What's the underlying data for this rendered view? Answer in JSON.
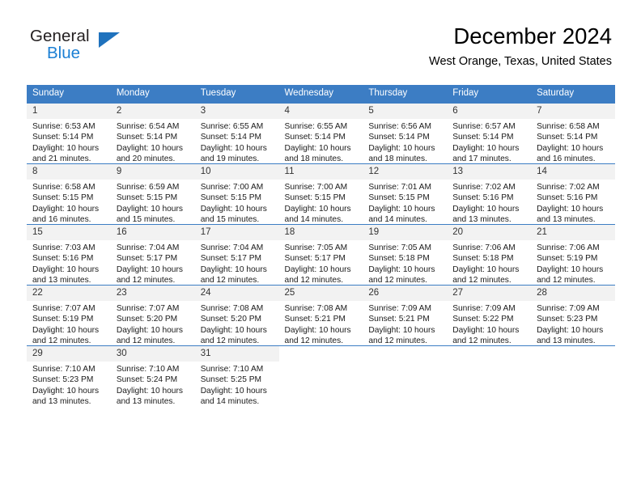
{
  "brand": {
    "name_part1": "General",
    "name_part2": "Blue",
    "logo_icon": "triangle-flag-icon",
    "accent_color": "#1f72bd"
  },
  "header": {
    "month_title": "December 2024",
    "location": "West Orange, Texas, United States"
  },
  "theme": {
    "header_row_bg": "#3c7dc4",
    "day_number_bg": "#f2f2f2",
    "text_color": "#1a1a1a"
  },
  "weekday_headers": [
    "Sunday",
    "Monday",
    "Tuesday",
    "Wednesday",
    "Thursday",
    "Friday",
    "Saturday"
  ],
  "weeks": [
    [
      {
        "day": "1",
        "detail": "Sunrise: 6:53 AM\nSunset: 5:14 PM\nDaylight: 10 hours\nand 21 minutes."
      },
      {
        "day": "2",
        "detail": "Sunrise: 6:54 AM\nSunset: 5:14 PM\nDaylight: 10 hours\nand 20 minutes."
      },
      {
        "day": "3",
        "detail": "Sunrise: 6:55 AM\nSunset: 5:14 PM\nDaylight: 10 hours\nand 19 minutes."
      },
      {
        "day": "4",
        "detail": "Sunrise: 6:55 AM\nSunset: 5:14 PM\nDaylight: 10 hours\nand 18 minutes."
      },
      {
        "day": "5",
        "detail": "Sunrise: 6:56 AM\nSunset: 5:14 PM\nDaylight: 10 hours\nand 18 minutes."
      },
      {
        "day": "6",
        "detail": "Sunrise: 6:57 AM\nSunset: 5:14 PM\nDaylight: 10 hours\nand 17 minutes."
      },
      {
        "day": "7",
        "detail": "Sunrise: 6:58 AM\nSunset: 5:14 PM\nDaylight: 10 hours\nand 16 minutes."
      }
    ],
    [
      {
        "day": "8",
        "detail": "Sunrise: 6:58 AM\nSunset: 5:15 PM\nDaylight: 10 hours\nand 16 minutes."
      },
      {
        "day": "9",
        "detail": "Sunrise: 6:59 AM\nSunset: 5:15 PM\nDaylight: 10 hours\nand 15 minutes."
      },
      {
        "day": "10",
        "detail": "Sunrise: 7:00 AM\nSunset: 5:15 PM\nDaylight: 10 hours\nand 15 minutes."
      },
      {
        "day": "11",
        "detail": "Sunrise: 7:00 AM\nSunset: 5:15 PM\nDaylight: 10 hours\nand 14 minutes."
      },
      {
        "day": "12",
        "detail": "Sunrise: 7:01 AM\nSunset: 5:15 PM\nDaylight: 10 hours\nand 14 minutes."
      },
      {
        "day": "13",
        "detail": "Sunrise: 7:02 AM\nSunset: 5:16 PM\nDaylight: 10 hours\nand 13 minutes."
      },
      {
        "day": "14",
        "detail": "Sunrise: 7:02 AM\nSunset: 5:16 PM\nDaylight: 10 hours\nand 13 minutes."
      }
    ],
    [
      {
        "day": "15",
        "detail": "Sunrise: 7:03 AM\nSunset: 5:16 PM\nDaylight: 10 hours\nand 13 minutes."
      },
      {
        "day": "16",
        "detail": "Sunrise: 7:04 AM\nSunset: 5:17 PM\nDaylight: 10 hours\nand 12 minutes."
      },
      {
        "day": "17",
        "detail": "Sunrise: 7:04 AM\nSunset: 5:17 PM\nDaylight: 10 hours\nand 12 minutes."
      },
      {
        "day": "18",
        "detail": "Sunrise: 7:05 AM\nSunset: 5:17 PM\nDaylight: 10 hours\nand 12 minutes."
      },
      {
        "day": "19",
        "detail": "Sunrise: 7:05 AM\nSunset: 5:18 PM\nDaylight: 10 hours\nand 12 minutes."
      },
      {
        "day": "20",
        "detail": "Sunrise: 7:06 AM\nSunset: 5:18 PM\nDaylight: 10 hours\nand 12 minutes."
      },
      {
        "day": "21",
        "detail": "Sunrise: 7:06 AM\nSunset: 5:19 PM\nDaylight: 10 hours\nand 12 minutes."
      }
    ],
    [
      {
        "day": "22",
        "detail": "Sunrise: 7:07 AM\nSunset: 5:19 PM\nDaylight: 10 hours\nand 12 minutes."
      },
      {
        "day": "23",
        "detail": "Sunrise: 7:07 AM\nSunset: 5:20 PM\nDaylight: 10 hours\nand 12 minutes."
      },
      {
        "day": "24",
        "detail": "Sunrise: 7:08 AM\nSunset: 5:20 PM\nDaylight: 10 hours\nand 12 minutes."
      },
      {
        "day": "25",
        "detail": "Sunrise: 7:08 AM\nSunset: 5:21 PM\nDaylight: 10 hours\nand 12 minutes."
      },
      {
        "day": "26",
        "detail": "Sunrise: 7:09 AM\nSunset: 5:21 PM\nDaylight: 10 hours\nand 12 minutes."
      },
      {
        "day": "27",
        "detail": "Sunrise: 7:09 AM\nSunset: 5:22 PM\nDaylight: 10 hours\nand 12 minutes."
      },
      {
        "day": "28",
        "detail": "Sunrise: 7:09 AM\nSunset: 5:23 PM\nDaylight: 10 hours\nand 13 minutes."
      }
    ],
    [
      {
        "day": "29",
        "detail": "Sunrise: 7:10 AM\nSunset: 5:23 PM\nDaylight: 10 hours\nand 13 minutes."
      },
      {
        "day": "30",
        "detail": "Sunrise: 7:10 AM\nSunset: 5:24 PM\nDaylight: 10 hours\nand 13 minutes."
      },
      {
        "day": "31",
        "detail": "Sunrise: 7:10 AM\nSunset: 5:25 PM\nDaylight: 10 hours\nand 14 minutes."
      },
      {
        "day": "",
        "detail": ""
      },
      {
        "day": "",
        "detail": ""
      },
      {
        "day": "",
        "detail": ""
      },
      {
        "day": "",
        "detail": ""
      }
    ]
  ]
}
